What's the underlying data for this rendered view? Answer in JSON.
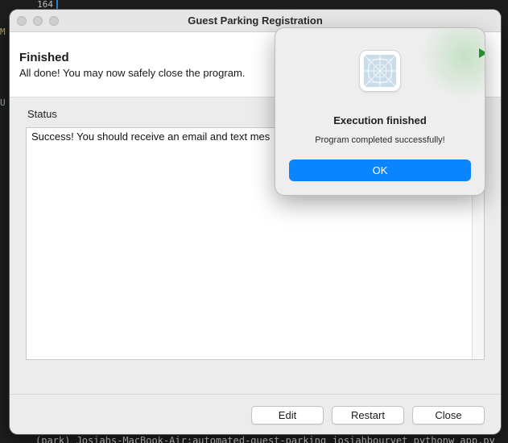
{
  "background": {
    "line_number": "164",
    "marker_m": "M",
    "marker_u": "U",
    "terminal_line": "(park) Josiahs-MacBook-Air:automated-guest-parking josiahbourvet pythonw app.py"
  },
  "window": {
    "title": "Guest Parking Registration"
  },
  "header": {
    "title": "Finished",
    "subtitle": "All done! You may now safely close the program."
  },
  "status": {
    "label": "Status",
    "text": "Success! You should receive an email and text mes"
  },
  "buttons": {
    "edit": "Edit",
    "restart": "Restart",
    "close": "Close"
  },
  "dialog": {
    "icon": "app-generic-icon",
    "title": "Execution finished",
    "message": "Program completed successfully!",
    "ok_label": "OK"
  },
  "colors": {
    "accent": "#0a84ff",
    "window_bg": "#ececec",
    "terminal_bg": "#1e1e1e"
  }
}
